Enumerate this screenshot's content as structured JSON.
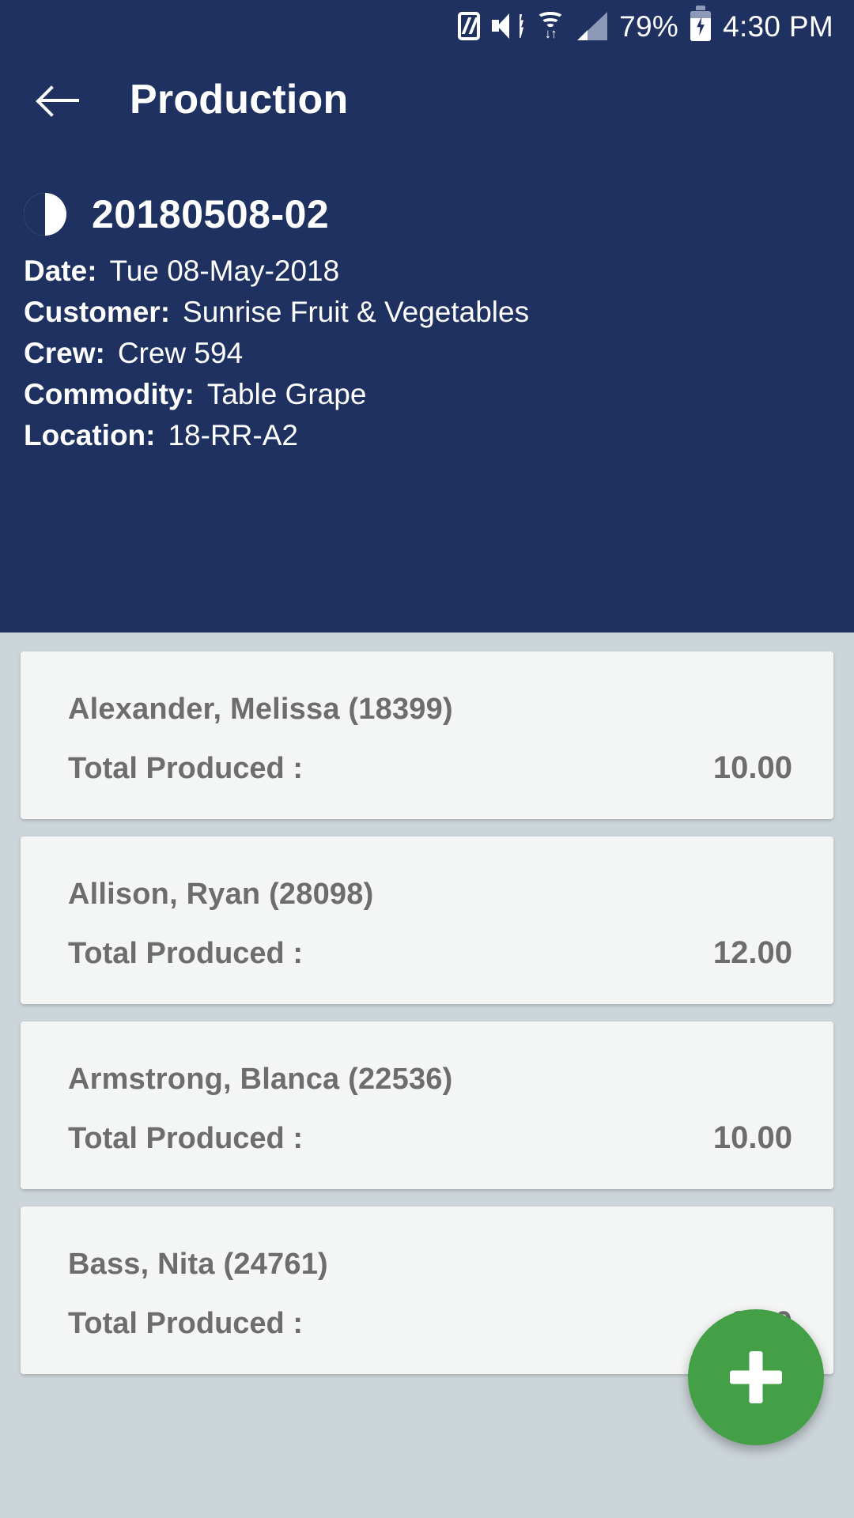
{
  "statusbar": {
    "icons": [
      "nfc-icon",
      "mute-vibrate-icon",
      "wifi-icon",
      "signal-icon",
      "battery-icon"
    ],
    "battery_percent": "79%",
    "time": "4:30 PM"
  },
  "header": {
    "back_icon": "back-arrow-icon",
    "title": "Production",
    "record_icon": "half-circle-icon",
    "record_id": "20180508-02",
    "fields": [
      {
        "label": "Date:",
        "value": "Tue 08-May-2018"
      },
      {
        "label": "Customer:",
        "value": "Sunrise Fruit & Vegetables"
      },
      {
        "label": "Crew:",
        "value": "Crew 594"
      },
      {
        "label": "Commodity:",
        "value": "Table Grape"
      },
      {
        "label": "Location:",
        "value": "18-RR-A2"
      }
    ]
  },
  "list": {
    "total_label": "Total Produced :",
    "items": [
      {
        "name": "Alexander, Melissa (18399)",
        "total_label": "Total Produced :",
        "total": "10.00"
      },
      {
        "name": "Allison, Ryan (28098)",
        "total_label": "Total Produced :",
        "total": "12.00"
      },
      {
        "name": "Armstrong, Blanca (22536)",
        "total_label": "Total Produced :",
        "total": "10.00"
      },
      {
        "name": "Bass, Nita (24761)",
        "total_label": "Total Produced :",
        "total": "8.00"
      }
    ]
  },
  "fab": {
    "icon": "plus-icon",
    "label": "Add"
  },
  "colors": {
    "header_bg": "#1e3160",
    "page_bg": "#ccd5da",
    "card_bg": "#f4f5f5",
    "card_text": "#6d6d6d",
    "fab_green": "#43a047",
    "status_dim": "#8c9ab8"
  }
}
